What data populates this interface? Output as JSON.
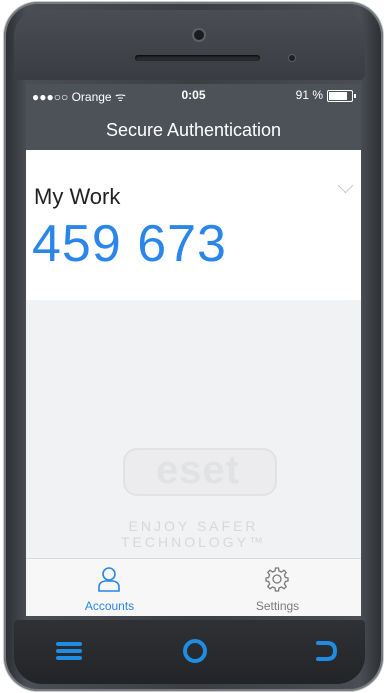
{
  "status": {
    "carrier": "●●●○○ Orange ",
    "wifi": "ᯤ",
    "time": "0:05",
    "battery": "91 %",
    "battery_level": 0.91
  },
  "nav": {
    "title": "Secure Authentication"
  },
  "account": {
    "name": "My Work",
    "code": "459 673"
  },
  "branding": {
    "logo": "eset",
    "tagline_1": "ENJOY SAFER",
    "tagline_2": "TECHNOLOGY™"
  },
  "tabs": [
    {
      "label": "Accounts",
      "icon": "user-icon",
      "active": true
    },
    {
      "label": "Settings",
      "icon": "gear-icon",
      "active": false
    }
  ],
  "hardware": {
    "menu": "menu-icon",
    "home": "home-icon",
    "back": "back-icon"
  },
  "colors": {
    "accent": "#2a86e8",
    "nav_bg": "#4d5258",
    "hw_blue": "#1e8de3"
  }
}
